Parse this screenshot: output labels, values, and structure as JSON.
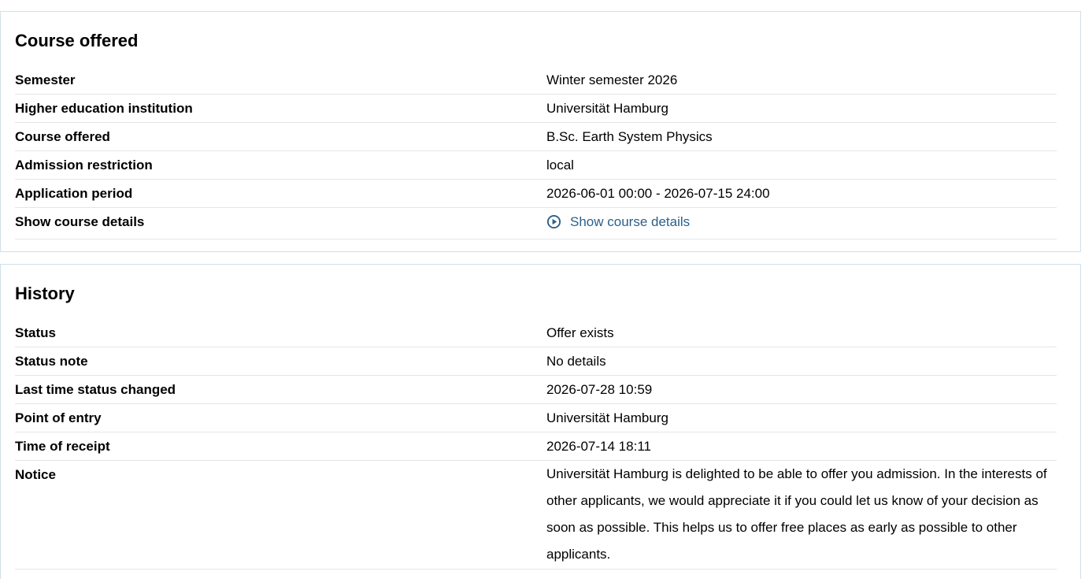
{
  "course_panel": {
    "title": "Course offered",
    "rows": [
      {
        "label": "Semester",
        "value": "Winter semester 2026"
      },
      {
        "label": "Higher education institution",
        "value": "Universität Hamburg"
      },
      {
        "label": "Course offered",
        "value": "B.Sc. Earth System Physics"
      },
      {
        "label": "Admission restriction",
        "value": "local"
      },
      {
        "label": "Application period",
        "value": "2026-06-01 00:00 - 2026-07-15 24:00"
      },
      {
        "label": "Show course details",
        "value": "Show course details",
        "icon": "play-circle-icon"
      }
    ]
  },
  "history_panel": {
    "title": "History",
    "rows": [
      {
        "label": "Status",
        "value": "Offer exists"
      },
      {
        "label": "Status note",
        "value": "No details"
      },
      {
        "label": "Last time status changed",
        "value": "2026-07-28 10:59"
      },
      {
        "label": "Point of entry",
        "value": "Universität Hamburg"
      },
      {
        "label": "Time of receipt",
        "value": "2026-07-14 18:11"
      },
      {
        "label": "Notice",
        "value": "Universität Hamburg is delighted to be able to offer you admission. In the interests of other applicants, we would appreciate it if you could let us know of your decision as soon as possible. This helps us to offer free places as early as possible to other applicants."
      }
    ]
  },
  "colors": {
    "link": "#2b5f8a",
    "border": "#cfe0ea",
    "row_divider": "#e2e6ea"
  }
}
